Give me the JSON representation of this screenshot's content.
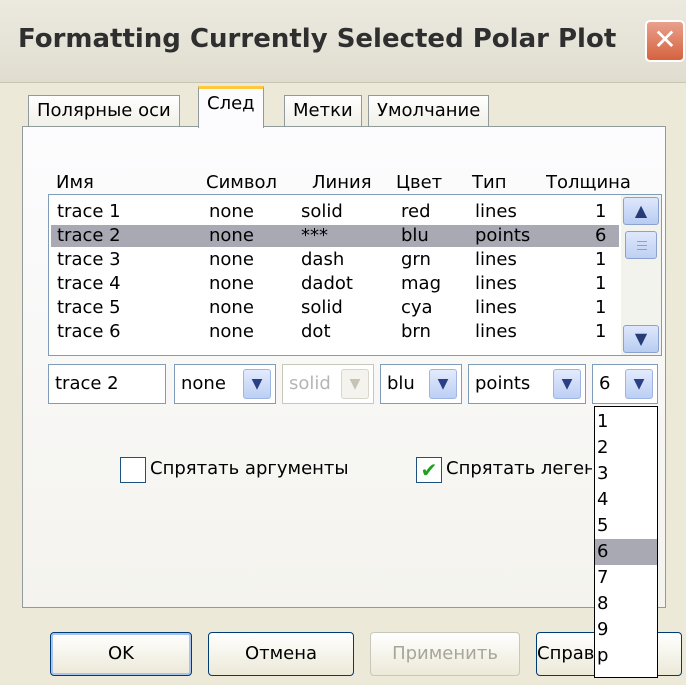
{
  "window": {
    "title": "Formatting Currently Selected Polar Plot",
    "close_glyph": "✕"
  },
  "tabs": [
    {
      "label": "Полярные оси"
    },
    {
      "label": "След"
    },
    {
      "label": "Метки"
    },
    {
      "label": "Умолчание"
    }
  ],
  "active_tab": "След",
  "columns": [
    "Имя",
    "Символ",
    "Линия",
    "Цвет",
    "Тип",
    "Толщина"
  ],
  "traces": [
    {
      "name": "trace 1",
      "symbol": "none",
      "line": "solid",
      "color": "red",
      "type": "lines",
      "weight": "1"
    },
    {
      "name": "trace 2",
      "symbol": "none",
      "line": "***",
      "color": "blu",
      "type": "points",
      "weight": "6"
    },
    {
      "name": "trace 3",
      "symbol": "none",
      "line": "dash",
      "color": "grn",
      "type": "lines",
      "weight": "1"
    },
    {
      "name": "trace 4",
      "symbol": "none",
      "line": "dadot",
      "color": "mag",
      "type": "lines",
      "weight": "1"
    },
    {
      "name": "trace 5",
      "symbol": "none",
      "line": "solid",
      "color": "cya",
      "type": "lines",
      "weight": "1"
    },
    {
      "name": "trace 6",
      "symbol": "none",
      "line": "dot",
      "color": "brn",
      "type": "lines",
      "weight": "1"
    }
  ],
  "selected_trace_index": 1,
  "editor": {
    "name": "trace 2",
    "symbol": "none",
    "line": "solid",
    "color": "blu",
    "type": "points",
    "weight": "6"
  },
  "weight_options": [
    "1",
    "2",
    "3",
    "4",
    "5",
    "6",
    "7",
    "8",
    "9",
    "p"
  ],
  "weight_selected": "6",
  "checkboxes": [
    {
      "label": "Спрятать аргументы",
      "checked": false
    },
    {
      "label": "Спрятать легенду",
      "checked": true
    }
  ],
  "buttons": {
    "ok": "OK",
    "cancel": "Отмена",
    "apply": "Применить",
    "help": "Справка"
  },
  "icons": {
    "scroll_up": "chevron-up-icon",
    "scroll_down": "chevron-down-icon",
    "dropdown": "chevron-down-icon",
    "check": "✔"
  },
  "colors": {
    "selection": "#a9a9b4",
    "tab_accent": "#ffc83c",
    "close": "#d5623f"
  }
}
